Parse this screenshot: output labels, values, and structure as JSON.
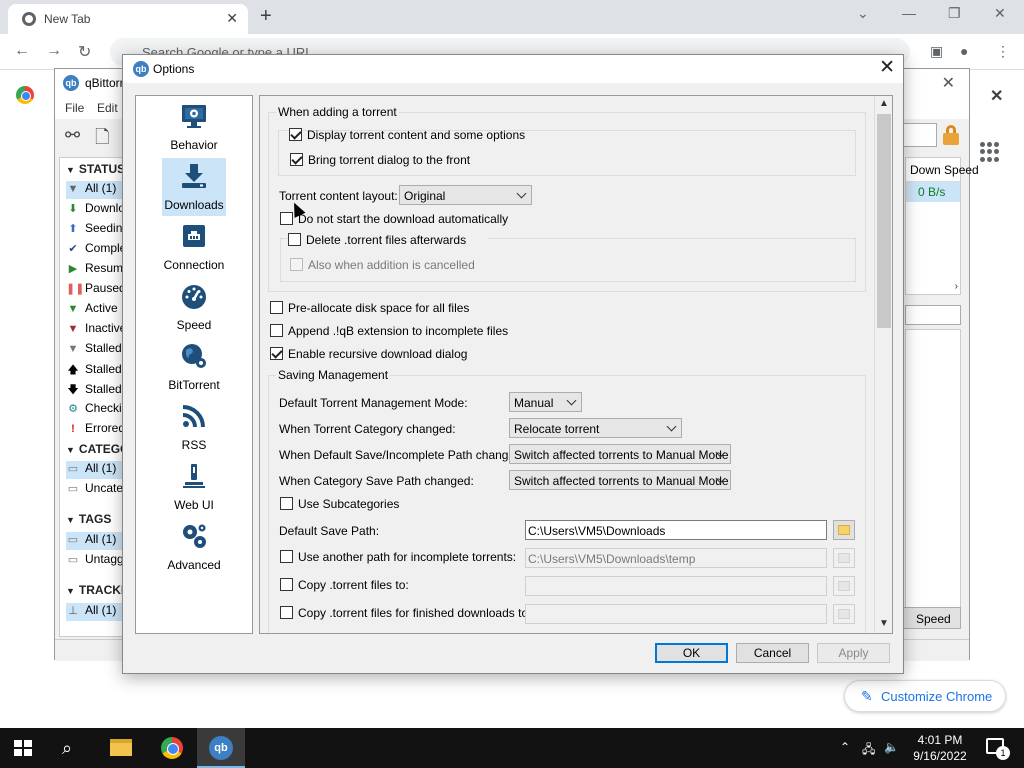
{
  "chrome": {
    "tab_title": "New Tab",
    "omnibox_placeholder": "Search Google or type a URL",
    "customize_label": "Customize Chrome"
  },
  "qbt": {
    "title": "qBittorrent",
    "menu": [
      "File",
      "Edit"
    ],
    "status_header": "STATUS",
    "status_items": [
      "All (1)",
      "Downloading",
      "Seeding",
      "Completed",
      "Resumed",
      "Paused",
      "Active",
      "Inactive",
      "Stalled",
      "Stalled",
      "Stalled",
      "Checking",
      "Errored"
    ],
    "categories_header": "CATEGORIES",
    "category_items": [
      "All (1)",
      "Uncategorized"
    ],
    "tags_header": "TAGS",
    "tag_items": [
      "All (1)",
      "Untagged"
    ],
    "trackers_header": "TRACKERS",
    "tracker_items": [
      "All (1)"
    ],
    "list_header": "Down Speed",
    "list_value": "0 B/s",
    "speed_button": "Speed"
  },
  "dialog": {
    "title": "Options",
    "categories": [
      "Behavior",
      "Downloads",
      "Connection",
      "Speed",
      "BitTorrent",
      "RSS",
      "Web UI",
      "Advanced"
    ],
    "selected_category": "Downloads",
    "adding_group": "When adding a torrent",
    "display_content": "Display torrent content and some options",
    "bring_front": "Bring torrent dialog to the front",
    "layout_label": "Torrent content layout:",
    "layout_value": "Original",
    "not_start": "Do not start the download automatically",
    "delete_torrent": "Delete .torrent files afterwards",
    "also_cancelled": "Also when addition is cancelled",
    "preallocate": "Pre-allocate disk space for all files",
    "append_ext": "Append .!qB extension to incomplete files",
    "recursive": "Enable recursive download dialog",
    "saving_group": "Saving Management",
    "tmm_label": "Default Torrent Management Mode:",
    "tmm_value": "Manual",
    "cat_changed_label": "When Torrent Category changed:",
    "cat_changed_value": "Relocate torrent",
    "default_path_changed_label": "When Default Save/Incomplete Path changed:",
    "default_path_changed_value": "Switch affected torrents to Manual Mode",
    "cat_path_changed_label": "When Category Save Path changed:",
    "cat_path_changed_value": "Switch affected torrents to Manual Mode",
    "subcategories": "Use Subcategories",
    "save_path_label": "Default Save Path:",
    "save_path_value": "C:\\Users\\VM5\\Downloads",
    "incomplete_path": "Use another path for incomplete torrents:",
    "incomplete_path_value": "C:\\Users\\VM5\\Downloads\\temp",
    "copy_torrent": "Copy .torrent files to:",
    "copy_finished": "Copy .torrent files for finished downloads to:",
    "ok": "OK",
    "cancel": "Cancel",
    "apply": "Apply"
  },
  "taskbar": {
    "time": "4:01 PM",
    "date": "9/16/2022",
    "notification_count": "1"
  }
}
